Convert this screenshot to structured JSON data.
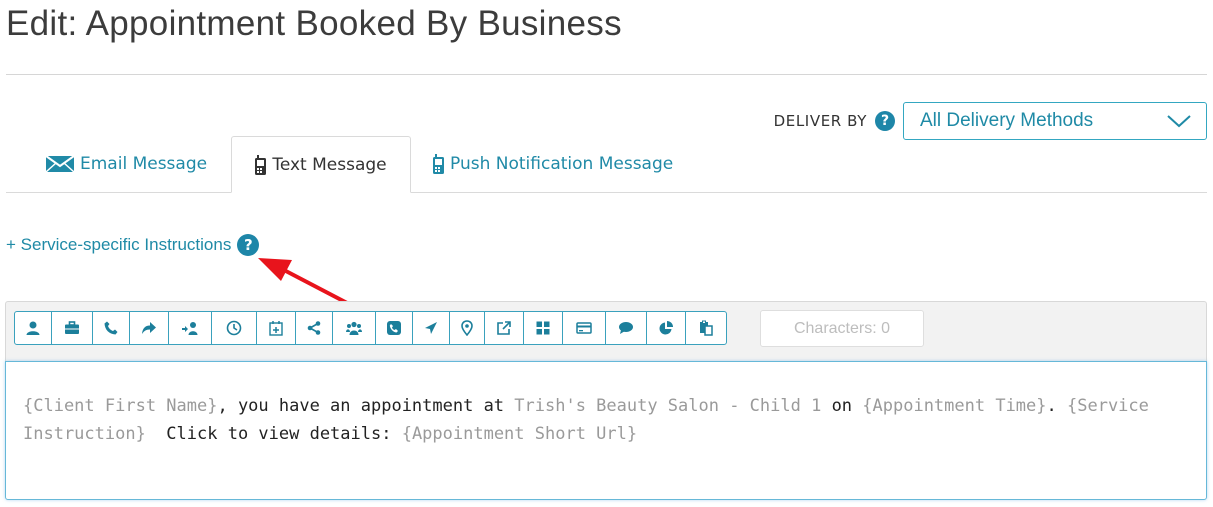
{
  "page": {
    "title": "Edit: Appointment Booked By Business"
  },
  "deliver": {
    "label": "DELIVER BY",
    "help": "?",
    "selected": "All Delivery Methods"
  },
  "tabs": [
    {
      "label": "Email Message",
      "icon": "envelope-icon",
      "active": false
    },
    {
      "label": "Text Message",
      "icon": "mobile-phone-icon",
      "active": true
    },
    {
      "label": "Push Notification Message",
      "icon": "mobile-phone-icon",
      "active": false
    }
  ],
  "service_link": {
    "label": "+ Service-specific Instructions",
    "help": "?"
  },
  "toolbar": {
    "buttons": [
      "user-icon",
      "briefcase-icon",
      "phone-icon",
      "share-arrow-icon",
      "user-forward-icon",
      "clock-icon",
      "calendar-plus-icon",
      "share-icon",
      "users-icon",
      "phone-square-icon",
      "location-arrow-icon",
      "map-marker-icon",
      "external-link-icon",
      "grid-icon",
      "credit-card-icon",
      "comments-icon",
      "pie-chart-icon",
      "paste-icon"
    ],
    "characters_label": "Characters: 0"
  },
  "message": [
    {
      "text": "{Client First Name}",
      "placeholder": true
    },
    {
      "text": ", you have an appointment at ",
      "placeholder": false
    },
    {
      "text": "Trish's Beauty Salon - Child 1",
      "placeholder": true
    },
    {
      "text": " on ",
      "placeholder": false
    },
    {
      "text": "{Appointment Time}",
      "placeholder": true
    },
    {
      "text": ". ",
      "placeholder": false
    },
    {
      "text": "{Service Instruction}",
      "placeholder": true
    },
    {
      "text": "  Click to view details: ",
      "placeholder": false
    },
    {
      "text": "{Appointment Short Url}",
      "placeholder": true
    }
  ],
  "colors": {
    "link": "#1f8aa6",
    "accent": "#34a7c1",
    "annotation_arrow": "#e8141c",
    "placeholder": "#9a9a9a"
  }
}
